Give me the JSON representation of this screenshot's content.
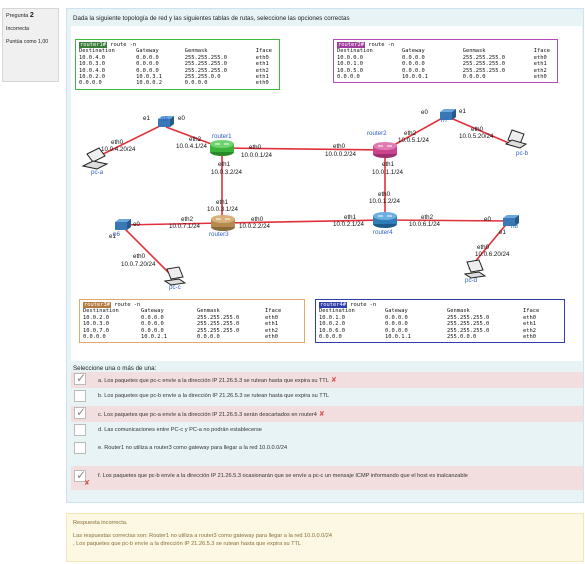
{
  "question_info": {
    "label": "Pregunta",
    "number": "2",
    "state": "Incorrecta",
    "mark": "Puntúa como 1,00"
  },
  "question": {
    "text": "Dada la siguiente topología de red y las siguientes tablas de rutas, seleccione las opciones correctas"
  },
  "routing_tables": {
    "router1": {
      "host": "router1#",
      "cmd": " route -n",
      "headers": [
        "Destination",
        "Gateway",
        "Genmask",
        "Iface"
      ],
      "rows": [
        [
          "10.0.4.0",
          "0.0.0.0",
          "255.255.255.0",
          "eth0"
        ],
        [
          "10.0.3.0",
          "0.0.0.0",
          "255.255.255.0",
          "eth1"
        ],
        [
          "10.0.4.0",
          "0.0.0.0",
          "255.255.255.0",
          "eth2"
        ],
        [
          "10.0.2.0",
          "10.0.3.1",
          "255.255.0.0",
          "eth1"
        ],
        [
          "0.0.0.0",
          "10.0.0.2",
          "0.0.0.0",
          "eth0"
        ]
      ]
    },
    "router2": {
      "host": "router2#",
      "cmd": " route -n",
      "headers": [
        "Destination",
        "Gateway",
        "Genmask",
        "Iface"
      ],
      "rows": [
        [
          "10.0.0.0",
          "0.0.0.0",
          "255.255.255.0",
          "eth0"
        ],
        [
          "10.0.1.0",
          "0.0.0.0",
          "255.255.255.0",
          "eth1"
        ],
        [
          "10.0.5.0",
          "0.0.0.0",
          "255.255.255.0",
          "eth2"
        ],
        [
          "0.0.0.0",
          "10.0.0.1",
          "0.0.0.0",
          "eth0"
        ]
      ]
    },
    "router3": {
      "host": "router3#",
      "cmd": " route -n",
      "headers": [
        "Destination",
        "Gateway",
        "Genmask",
        "Iface"
      ],
      "rows": [
        [
          "10.0.2.0",
          "0.0.0.0",
          "255.255.255.0",
          "eth0"
        ],
        [
          "10.0.3.0",
          "0.0.0.0",
          "255.255.255.0",
          "eth1"
        ],
        [
          "10.0.7.0",
          "0.0.0.0",
          "255.255.255.0",
          "eth2"
        ],
        [
          "0.0.0.0",
          "10.0.2.1",
          "0.0.0.0",
          "eth0"
        ]
      ]
    },
    "router4": {
      "host": "router4#",
      "cmd": " route -n",
      "headers": [
        "Destination",
        "Gateway",
        "Genmask",
        "Iface"
      ],
      "rows": [
        [
          "10.0.1.0",
          "0.0.0.0",
          "255.255.255.0",
          "eth0"
        ],
        [
          "10.0.2.0",
          "0.0.0.0",
          "255.255.255.0",
          "eth1"
        ],
        [
          "10.0.6.0",
          "0.0.0.0",
          "255.255.255.0",
          "eth2"
        ],
        [
          "0.0.0.0",
          "10.0.1.1",
          "255.0.0.0",
          "eth0"
        ]
      ]
    }
  },
  "topology": {
    "routers": [
      "router1",
      "router2",
      "router3",
      "router4"
    ],
    "switches": [
      "n5",
      "n6",
      "n7",
      "n8"
    ],
    "pcs": [
      "pc-a",
      "pc-b",
      "pc-c",
      "pc-d"
    ],
    "labels": {
      "n5_e1": "e1",
      "n5_e0": "e0",
      "n5": "n5",
      "pca_eth0": "eth0",
      "pca_ip": "10.0.4.20/24",
      "pca": "pc-a",
      "r1_eth2": "eth2",
      "r1_eth2_ip": "10.0.4.1/24",
      "r1_eth0": "eth0",
      "r1_eth0_ip": "10.0.0.1/24",
      "r1_eth1": "eth1",
      "r1_eth1_ip": "10.0.3.2/24",
      "r2_eth0": "eth0",
      "r2_eth0_ip": "10.0.0.2/24",
      "r2_eth2": "eth2",
      "r2_eth2_ip": "10.0.5.1/24",
      "r2_eth1": "eth1",
      "r2_eth1_ip": "10.0.1.1/24",
      "n7_e0": "e0",
      "n7_e1": "e1",
      "n7": "n7",
      "pcb_eth0": "eth0",
      "pcb_ip": "10.0.5.20/24",
      "pcb": "pc-b",
      "r3_eth1": "eth1",
      "r3_eth1_ip": "10.0.3.1/24",
      "r3_eth2": "eth2",
      "r3_eth2_ip": "10.0.7.1/24",
      "r3_eth0": "eth0",
      "r3_eth0_ip": "10.0.2.2/24",
      "n6_e0": "e0",
      "n6_e1": "e1",
      "n6": "n6",
      "pcc_eth0": "eth0",
      "pcc_ip": "10.0.7.20/24",
      "pcc": "pc-c",
      "r4_eth0": "eth0",
      "r4_eth0_ip": "10.0.1.2/24",
      "r4_eth1": "eth1",
      "r4_eth1_ip": "10.0.2.1/24",
      "r4_eth2": "eth2",
      "r4_eth2_ip": "10.0.6.1/24",
      "n8_e0": "e0",
      "n8_e1": "e1",
      "n8": "n8",
      "pcd_eth0": "eth0",
      "pcd_ip": "10.0.6.20/24",
      "pcd": "pc-d"
    }
  },
  "prompt": "Seleccione una o más de una:",
  "options": [
    {
      "text": "a. Los paquetes que pc-c envíe a la dirección IP 21.26.5.3 se rutean hasta que expira su TTL",
      "checked": true,
      "incorrect": true,
      "mark": "✘"
    },
    {
      "text": "b. Los paquetes que pc-b envíe a la dirección IP 21.26.5.3 se rutean hasta que expira su TTL",
      "checked": false,
      "incorrect": false
    },
    {
      "text": "c. Los paquetes que pc-a envíe a la dirección IP 21.26.5.3 serán descartados en router4",
      "checked": true,
      "incorrect": true,
      "mark": "✘"
    },
    {
      "text": "d. Las comunicaciones entre PC-c y PC-a no podrán establecerse",
      "checked": false,
      "incorrect": false
    },
    {
      "text": "e. Router1 no utiliza a router3 como gateway para llegar a la red 10.0.0.0/24",
      "checked": false,
      "incorrect": false
    },
    {
      "text": "f. Los paquetes que pc-b envíe a la dirección IP 21.26.5.3 ocasionarán que se envíe a pc-c un mensaje ICMP informando que el host es inalcanzable",
      "checked": true,
      "incorrect": true,
      "mark": "✘"
    }
  ],
  "feedback": {
    "status": "Respuesta incorrecta.",
    "line1": "Las respuestas correctas son: Router1 no utiliza a router3 como gateway para llegar a la red 10.0.0.0/24",
    "line2": ", Los paquetes que pc-b envíe a la dirección IP 21.26.5.3 se rutean hasta que expira su TTL"
  },
  "colors": {
    "router1_border": "#3dbb3d",
    "router2_border": "#b54ab5",
    "router3_border": "#e3a96a",
    "router4_border": "#2f3ea8",
    "link_red": "#e0303a",
    "incorrect_bg": "#f2dede"
  }
}
